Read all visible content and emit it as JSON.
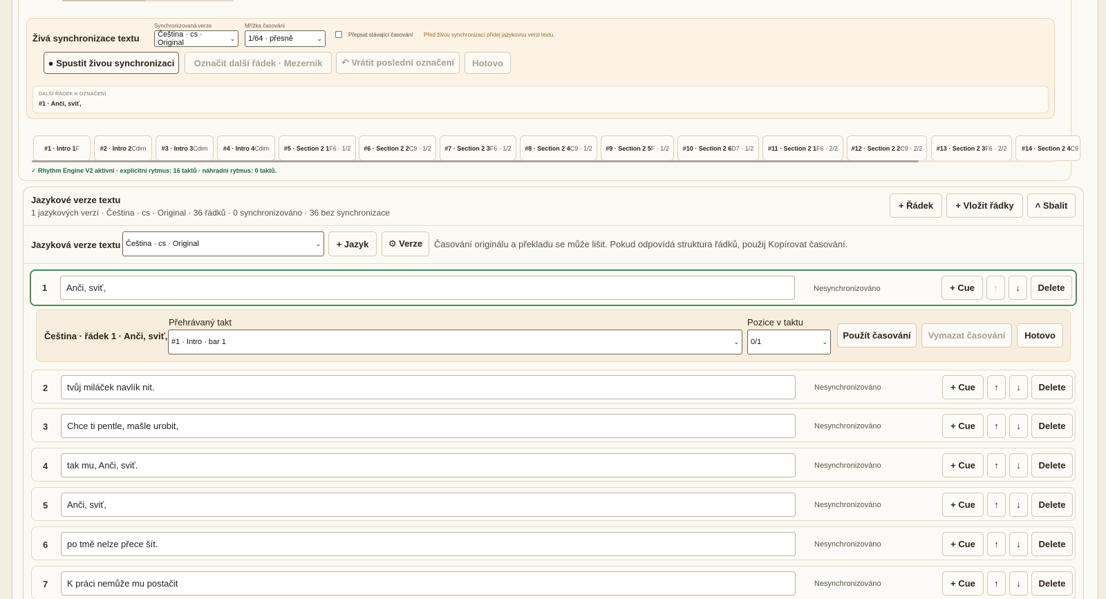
{
  "live_sync": {
    "title": "Živá synchronizace textu",
    "version_label": "Synchronizovaná verze",
    "version_value": "Čeština · cs · Original",
    "grid_label": "Mřížka časování",
    "grid_value": "1/64 · přesně",
    "overwrite_label": "Přepsat stávající časování",
    "hint": "Před živou synchronizací přidej jazykovou verzi textu.",
    "start_button": "● Spustit živou synchronizaci",
    "mark_next_button": "Označit další řádek · Mezerník",
    "undo_button": "↶ Vrátit poslední označení",
    "done_button": "Hotovo",
    "next_line_label": "DALŠÍ ŘÁDEK K OZNAČENÍ",
    "next_line_value": "#1 · Anči, sviť,"
  },
  "bar_tabs": [
    {
      "label": "#1 · Intro 1",
      "chord": "F"
    },
    {
      "label": "#2 · Intro 2",
      "chord": "Cdim"
    },
    {
      "label": "#3 · Intro 3",
      "chord": "Cdim"
    },
    {
      "label": "#4 · Intro 4",
      "chord": "Cdim"
    },
    {
      "label": "#5 · Section 2 1",
      "chord": "F6 · 1/2"
    },
    {
      "label": "#6 · Section 2 2",
      "chord": "C9 · 1/2"
    },
    {
      "label": "#7 · Section 2 3",
      "chord": "F6 · 1/2"
    },
    {
      "label": "#8 · Section 2 4",
      "chord": "C9 · 1/2"
    },
    {
      "label": "#9 · Section 2 5",
      "chord": "F · 1/2"
    },
    {
      "label": "#10 · Section 2 6",
      "chord": "D7 · 1/2"
    },
    {
      "label": "#11 · Section 2 1",
      "chord": "F6 · 2/2"
    },
    {
      "label": "#12 · Section 2 2",
      "chord": "C9 · 2/2"
    },
    {
      "label": "#13 · Section 2 3",
      "chord": "F6 · 2/2"
    },
    {
      "label": "#14 · Section 2 4",
      "chord": "C9"
    }
  ],
  "rhythm_status": "✓ Rhythm Engine V2 aktivní · explicitní rytmus: 16 taktů · náhradní rytmus: 0 taktů.",
  "lang_section": {
    "title": "Jazykové verze textu",
    "subtitle": "1 jazykových verzí · Čeština · cs · Original · 36 řádků · 0 synchronizováno · 36 bez synchronizace",
    "add_line_button": "+ Řádek",
    "insert_lines_button": "+ Vložit řádky",
    "collapse_button": "˄ Sbalit",
    "version_label": "Jazyková verze textu",
    "version_value": "Čeština · cs · Original",
    "add_language_button": "+ Jazyk",
    "versions_button": "⚙ Verze",
    "info": "Časování originálu a překladu se může lišit. Pokud odpovídá struktura řádků, použij Kopírovat časování."
  },
  "row_labels": {
    "status": "Nesynchronizováno",
    "cue": "+ Cue",
    "up": "↑",
    "down": "↓",
    "delete": "Delete"
  },
  "lines": [
    {
      "num": "1",
      "text": "Anči, sviť,"
    },
    {
      "num": "2",
      "text": "tvůj miláček navlík nit."
    },
    {
      "num": "3",
      "text": "Chce ti pentle, mašle urobit,"
    },
    {
      "num": "4",
      "text": "tak mu, Anči, sviť."
    },
    {
      "num": "5",
      "text": "Anči, sviť,"
    },
    {
      "num": "6",
      "text": "po tmě nelze přece šít."
    },
    {
      "num": "7",
      "text": "K práci nemůže mu postačit"
    }
  ],
  "timing_editor": {
    "title": "Čeština · řádek 1 · Anči, sviť,",
    "bar_label": "Přehrávaný takt",
    "bar_value": "#1 · Intro · bar 1",
    "position_label": "Pozice v taktu",
    "position_value": "0/1",
    "apply_button": "Použít časování",
    "clear_button": "Vymazat časování",
    "done_button": "Hotovo"
  },
  "colors": {
    "background": "#f3eee2",
    "panel": "#fdf3e5",
    "active_border": "#4c8a5c",
    "success_text": "#22693b"
  }
}
